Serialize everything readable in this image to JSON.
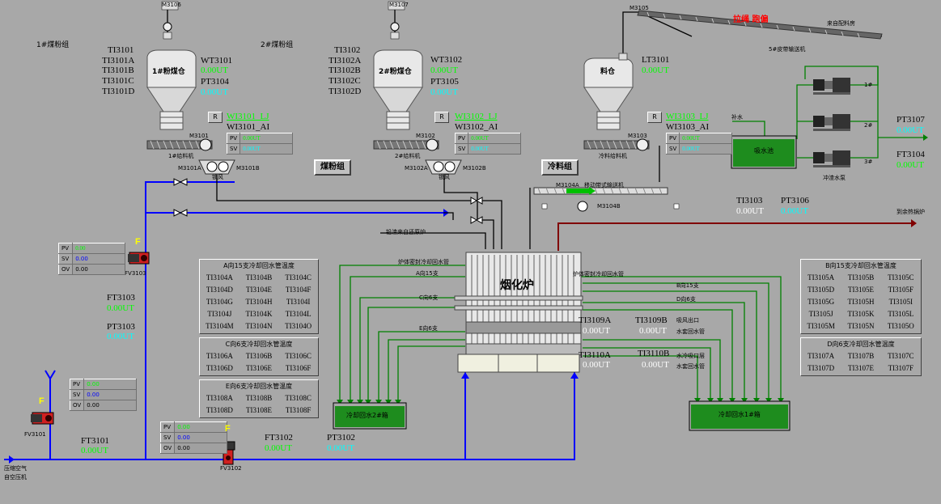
{
  "labels": {
    "group1": "1#煤粉组",
    "group2": "2#煤粉组",
    "m3106": "M3106",
    "m3107": "M3107",
    "m3105": "M3105",
    "bin1": "1#粉煤仓",
    "bin2": "2#粉煤仓",
    "bin3": "料仓",
    "belt_alarm": "拉绳  跑偏",
    "from_plant": "来自配料房",
    "belt_conveyor": "5#皮带输送机",
    "feeder1": "1#给料机",
    "feeder2": "2#给料机",
    "feeder3": "冷料给料机",
    "m3101": "M3101",
    "m3102": "M3102",
    "m3103": "M3103",
    "m3101a": "M3101A",
    "m3101b": "M3101B",
    "m3102a": "M3102A",
    "m3102b": "M3102B",
    "lock1": "锁风",
    "lock2": "锁风",
    "mobile_belt": "移动带式输送机",
    "m3104a": "M3104A",
    "m3104b": "M3104B",
    "makeup_water": "补水",
    "suction_pool": "吸水池",
    "pump_room": "冲渣水泵",
    "pump1": "1#",
    "pump2": "2#",
    "pump3": "3#",
    "fv3103": "FV3103",
    "fv3101": "FV3101",
    "fv3102": "FV3102",
    "compressed_air": "压缩空气",
    "from_compressor": "自空压机",
    "from_furnace": "铅渣来自还原炉",
    "furnace": "烟化炉",
    "to_waste_heat": "到余热锅炉",
    "furnace_ret1": "炉体密封冷却回水管",
    "furnace_ret2": "炉体密封冷却回水管",
    "a_ret": "A向15支",
    "c_ret": "C向6支",
    "e_ret": "E向6支",
    "b_ret": "B向15支",
    "d_ret": "D向6支",
    "tank2": "冷却回水2#箱",
    "tank1": "冷却回水1#箱",
    "air_outlet": "吸风出口",
    "air_outlet2": "水套回水管",
    "water_inlet": "水冷吸口层",
    "water_inlet2": "水套回水管"
  },
  "buttons": {
    "coal_group": "煤粉组",
    "cold_material": "冷料组",
    "r": "R"
  },
  "tags": {
    "ti3101": "TI3101",
    "ti3101a": "TI3101A",
    "ti3101b": "TI3101B",
    "ti3101c": "TI3101C",
    "ti3101d": "TI3101D",
    "wt3101": "WT3101",
    "wt3101_val": "0.00UT",
    "pt3104": "PT3104",
    "pt3104_val": "0.00UT",
    "ti3102": "TI3102",
    "ti3102a": "TI3102A",
    "ti3102b": "TI3102B",
    "ti3102c": "TI3102C",
    "ti3102d": "TI3102D",
    "wt3102": "WT3102",
    "wt3102_val": "0.00UT",
    "pt3105": "PT3105",
    "pt3105_val": "0.00UT",
    "lt3101": "LT3101",
    "lt3101_val": "0.00UT",
    "wi3101_lj": "WI3101_LJ",
    "wi3101_ai": "WI3101_AI",
    "wi3102_lj": "WI3102_LJ",
    "wi3102_ai": "WI3102_AI",
    "wi3103_lj": "WI3103_LJ",
    "wi3103_ai": "WI3103_AI",
    "pt3107": "PT3107",
    "pt3107_val": "0.00UT",
    "ft3104": "FT3104",
    "ft3104_val": "0.00UT",
    "ti3103": "TI3103",
    "ti3103_val": "0.00UT",
    "pt3106": "PT3106",
    "pt3106_val": "0.00UT",
    "ft3103": "FT3103",
    "ft3103_val": "0.00UT",
    "pt3103": "PT3103",
    "pt3103_val": "0.00UT",
    "ft3101": "FT3101",
    "ft3101_val": "0.00UT",
    "ft3102": "FT3102",
    "ft3102_val": "0.00UT",
    "pt3102": "PT3102",
    "pt3102_val": "0.00UT",
    "ti3109a": "TI3109A",
    "ti3109a_val": "0.00UT",
    "ti3109b": "TI3109B",
    "ti3109b_val": "0.00UT",
    "ti3110a": "TI3110A",
    "ti3110a_val": "0.00UT",
    "ti3110b": "TI3110B",
    "ti3110b_val": "0.00UT"
  },
  "pvsv": {
    "pv": "PV",
    "sv": "SV",
    "ov": "OV",
    "wi1_pv": "0.00UT",
    "wi1_sv": "0.00UT",
    "wi2_pv": "0.00UT",
    "wi2_sv": "0.00UT",
    "wi3_pv": "0.00UT",
    "wi3_sv": "0.00UT",
    "fv3103_pv": "0.00",
    "fv3103_sv": "0.00",
    "fv3103_ov": "0.00",
    "fv3101_pv": "0.00",
    "fv3101_sv": "0.00",
    "fv3101_ov": "0.00",
    "fv3102_pv": "0.00",
    "fv3102_sv": "0.00",
    "fv3102_ov": "0.00"
  },
  "valve_flag": "F",
  "panels": {
    "a": {
      "title": "A向15支冷却回水管温度",
      "cells": [
        "TI3104A",
        "TI3104B",
        "TI3104C",
        "TI3104D",
        "TI3104E",
        "TI3104F",
        "TI3104G",
        "TI3104H",
        "TI3104I",
        "TI3104J",
        "TI3104K",
        "TI3104L",
        "TI3104M",
        "TI3104N",
        "TI3104O"
      ]
    },
    "c": {
      "title": "C向6支冷却回水管温度",
      "cells": [
        "TI3106A",
        "TI3106B",
        "TI3106C",
        "TI3106D",
        "TI3106E",
        "TI3106F"
      ]
    },
    "e": {
      "title": "E向6支冷却回水管温度",
      "cells": [
        "TI3108A",
        "TI3108B",
        "TI3108C",
        "TI3108D",
        "TI3108E",
        "TI3108F"
      ]
    },
    "b": {
      "title": "B向15支冷却回水管温度",
      "cells": [
        "TI3105A",
        "TI3105B",
        "TI3105C",
        "TI3105D",
        "TI3105E",
        "TI3105F",
        "TI3105G",
        "TI3105H",
        "TI3105I",
        "TI3105J",
        "TI3105K",
        "TI3105L",
        "TI3105M",
        "TI3105N",
        "TI3105O"
      ]
    },
    "d": {
      "title": "D向6支冷却回水管温度",
      "cells": [
        "TI3107A",
        "TI3107B",
        "TI3107C",
        "TI3107D",
        "TI3107E",
        "TI3107F"
      ]
    }
  },
  "colors": {
    "background": "#a8a8a8",
    "air_pipe": "#0000ff",
    "water_pipe": "#008000",
    "flue_pipe": "#800000",
    "alarm_text": "#ff0000",
    "value_cyan": "#00ffff",
    "value_green": "#00ff00",
    "valve_flag": "#ffff00"
  }
}
